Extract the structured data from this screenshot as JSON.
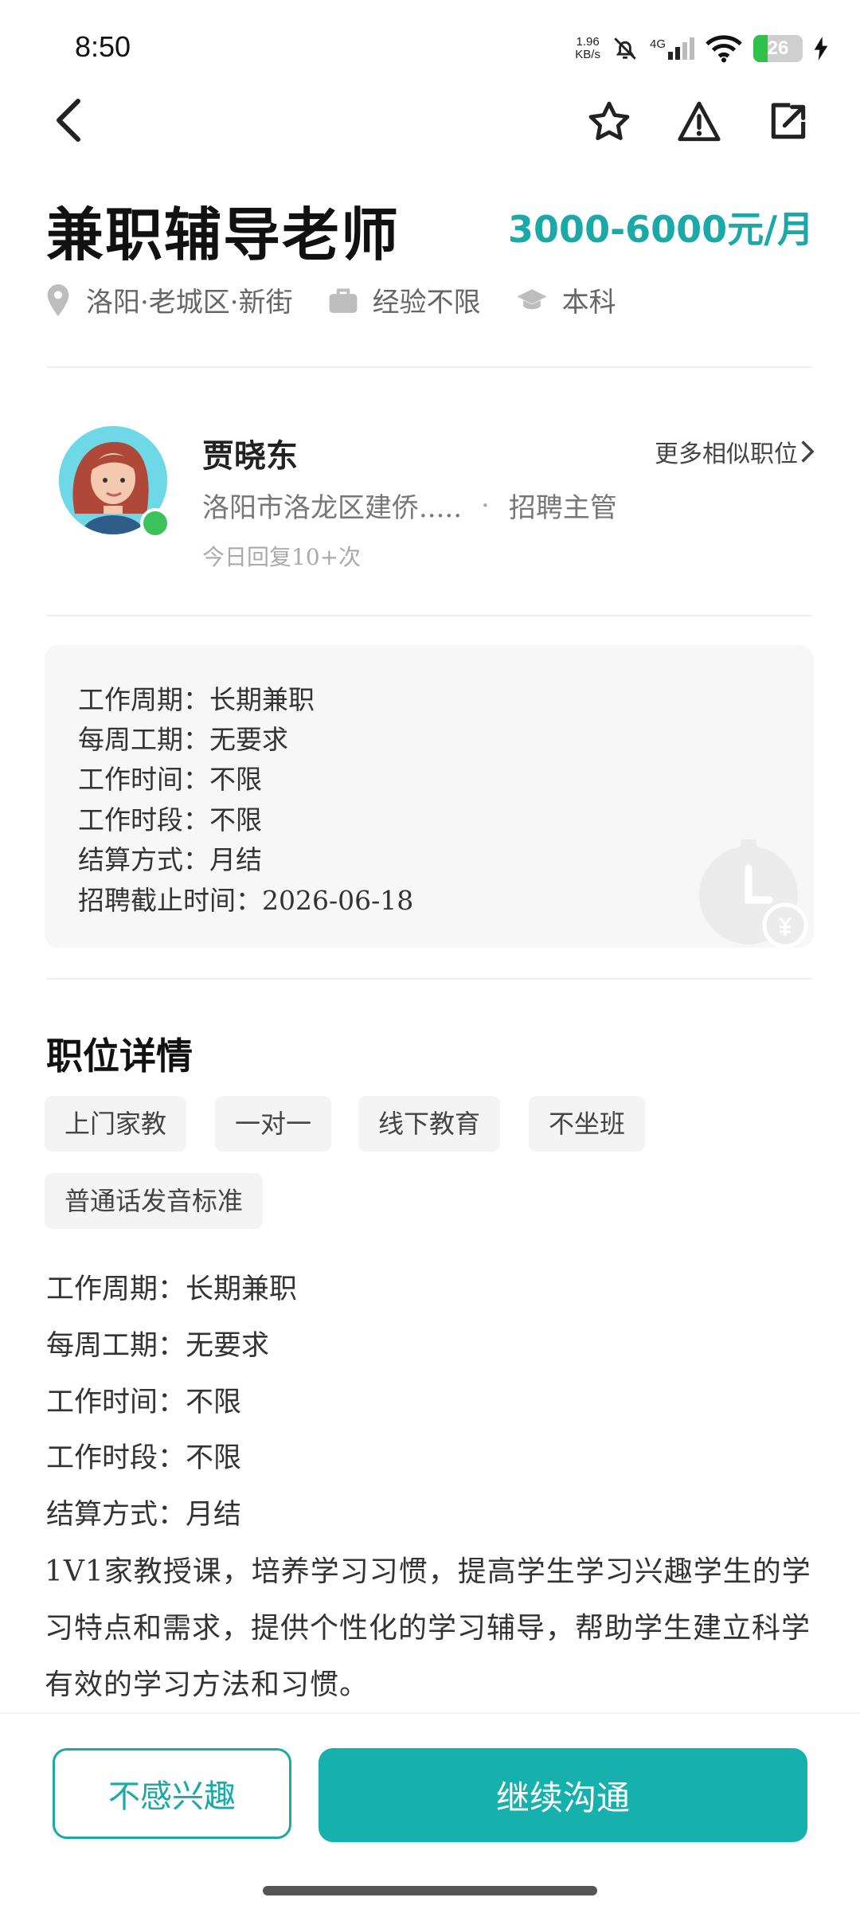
{
  "status_bar": {
    "time": "8:50",
    "net_speed_value": "1.96",
    "net_speed_unit": "KB/s",
    "network": "4G",
    "battery": "26"
  },
  "colors": {
    "accent": "#16b0ad",
    "salary": "#1aa9a6",
    "online": "#3cc25a"
  },
  "job": {
    "title": "兼职辅导老师",
    "salary": "3000-6000元/月",
    "location": "洛阳·老城区·新街",
    "experience": "经验不限",
    "education": "本科"
  },
  "recruiter": {
    "name": "贾晓东",
    "more_link": "更多相似职位",
    "company": "洛阳市洛龙区建侨.....",
    "separator": "·",
    "role": "招聘主管",
    "reply": "今日回复10+次"
  },
  "info_card": [
    "工作周期：长期兼职",
    "每周工期：无要求",
    "工作时间：不限",
    "工作时段：不限",
    "结算方式：月结",
    "招聘截止时间：2026-06-18"
  ],
  "details": {
    "title": "职位详情",
    "chips": [
      "上门家教",
      "一对一",
      "线下教育",
      "不坐班",
      "普通话发音标准"
    ],
    "rows": [
      "工作周期：长期兼职",
      "每周工期：无要求",
      "工作时间：不限",
      "工作时段：不限",
      "结算方式：月结"
    ],
    "description": "1V1家教授课，培养学习习惯，提高学生学习兴趣学生的学习特点和需求，提供个性化的学习辅导，帮助学生建立科学有效的学习方法和习惯。"
  },
  "actions": {
    "not_interested": "不感兴趣",
    "continue_chat": "继续沟通"
  }
}
